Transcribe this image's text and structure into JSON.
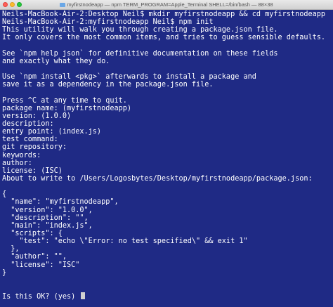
{
  "window": {
    "title": "myfirstnodeapp — npm TERM_PROGRAM=Apple_Terminal SHELL=/bin/bash — 88×38"
  },
  "terminal": {
    "lines": [
      "Neils-MacBook-Air-2:Desktop Neil$ mkdir myfirstnodeapp && cd myfirstnodeapp",
      "Neils-MacBook-Air-2:myfirstnodeapp Neil$ npm init",
      "This utility will walk you through creating a package.json file.",
      "It only covers the most common items, and tries to guess sensible defaults.",
      "",
      "See `npm help json` for definitive documentation on these fields",
      "and exactly what they do.",
      "",
      "Use `npm install <pkg>` afterwards to install a package and",
      "save it as a dependency in the package.json file.",
      "",
      "Press ^C at any time to quit.",
      "package name: (myfirstnodeapp)",
      "version: (1.0.0)",
      "description:",
      "entry point: (index.js)",
      "test command:",
      "git repository:",
      "keywords:",
      "author:",
      "license: (ISC)",
      "About to write to /Users/Logosbytes/Desktop/myfirstnodeapp/package.json:",
      "",
      "{",
      "  \"name\": \"myfirstnodeapp\",",
      "  \"version\": \"1.0.0\",",
      "  \"description\": \"\",",
      "  \"main\": \"index.js\",",
      "  \"scripts\": {",
      "    \"test\": \"echo \\\"Error: no test specified\\\" && exit 1\"",
      "  },",
      "  \"author\": \"\",",
      "  \"license\": \"ISC\"",
      "}",
      "",
      "",
      "Is this OK? (yes) "
    ]
  },
  "colors": {
    "background": "#1f2a85",
    "text": "#ffffff",
    "cursor": "#d0d0d0"
  }
}
